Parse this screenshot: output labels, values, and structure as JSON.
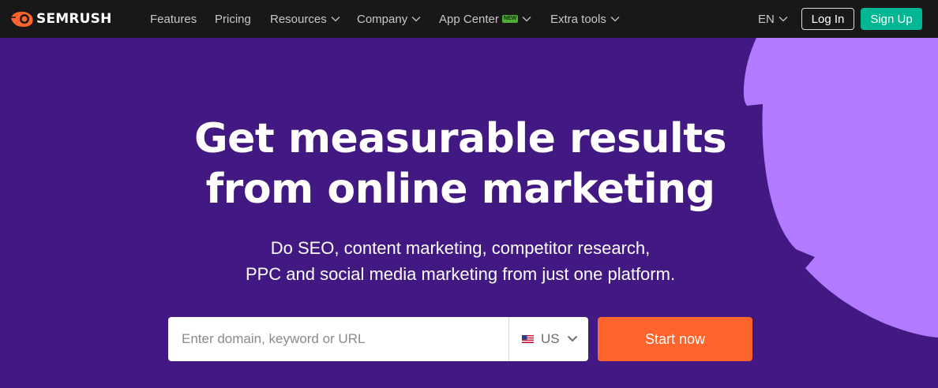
{
  "brand": {
    "name": "SEMRUSH",
    "accent": "#ff642d"
  },
  "nav": {
    "items": [
      {
        "label": "Features",
        "has_dropdown": false
      },
      {
        "label": "Pricing",
        "has_dropdown": false
      },
      {
        "label": "Resources",
        "has_dropdown": true
      },
      {
        "label": "Company",
        "has_dropdown": true
      },
      {
        "label": "App Center",
        "badge": "NEW",
        "has_dropdown": true
      },
      {
        "label": "Extra tools",
        "has_dropdown": true
      }
    ],
    "language": "EN",
    "login_label": "Log In",
    "signup_label": "Sign Up"
  },
  "hero": {
    "headline_line1": "Get measurable results",
    "headline_line2": "from online marketing",
    "sub_line1": "Do SEO, content marketing, competitor research,",
    "sub_line2": "PPC and social media marketing from just one platform."
  },
  "search": {
    "placeholder": "Enter domain, keyword or URL",
    "country": "US",
    "start_label": "Start now"
  },
  "colors": {
    "nav_bg": "#181818",
    "hero_bg": "#421983",
    "shape": "#b27bff",
    "signup": "#00b794",
    "badge": "#4eae35"
  }
}
